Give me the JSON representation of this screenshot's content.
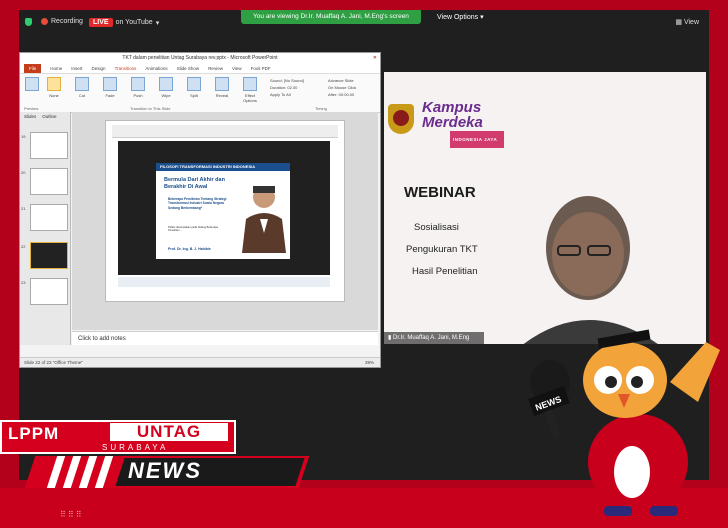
{
  "topbar": {
    "recording_label": "Recording",
    "live_badge": "LIVE",
    "youtube_label": "on YouTube",
    "screen_banner": "You are viewing Dr.Ir. Muaffaq A. Jani, M.Eng's screen",
    "view_options": "View Options",
    "view_button": "View"
  },
  "ppt": {
    "title": "TKT dalam penelitian Untag Surabaya rev.pptx - Microsoft PowerPoint",
    "tabs": [
      "File",
      "Home",
      "Insert",
      "Design",
      "Transitions",
      "Animations",
      "Slide Show",
      "Review",
      "View",
      "Foxit PDF"
    ],
    "ribbon": {
      "preview": "Preview",
      "transitions": [
        "None",
        "Cut",
        "Fade",
        "Push",
        "Wipe",
        "Split",
        "Reveal"
      ],
      "effect_options": "Effect Options",
      "group_transition": "Transition to This Slide",
      "sound": "Sound: [No Sound]",
      "duration": "Duration: 02.00",
      "apply_all": "Apply To All",
      "advance": "Advance Slide",
      "on_click": "On Mouse Click",
      "after": "After: 00:00.00",
      "group_timing": "Timing"
    },
    "pane_tabs": [
      "Slides",
      "Outline"
    ],
    "thumb_numbers": [
      "19",
      "20",
      "21",
      "22",
      "23"
    ],
    "slide": {
      "card_header": "FILOSOFI TRANSFORMASI INDUSTRI INDONESIA",
      "quote": "Bermula Dari Akhir dan Berakhir Di Awal",
      "subtext": "Beberapa Pemikiran Tentang Strategi Transformasi Industri Suatu Negara Sedang Berkembang*",
      "note": "Pidato disampaikan pada Sidang Beberapa Penelitian ...",
      "author": "Prof. Dr. Ing. B. J. Habibie"
    },
    "notes_placeholder": "Click to add notes",
    "status": "Slide 22 of 23   \"Office Theme\"",
    "zoom": "39%"
  },
  "webinar": {
    "brand_line1": "Kampus",
    "brand_line2": "Merdeka",
    "brand_tag": "INDONESIA JAYA",
    "title": "WEBINAR",
    "lines": [
      "Sosialisasi",
      "Pengukuran TKT",
      "Hasil Penelitian"
    ],
    "speaker_name": "Dr.Ir. Muaffaq A. Jani, M.Eng"
  },
  "overlay": {
    "lppm": "LPPM",
    "untag": "UNTAG",
    "surabaya": "SURABAYA",
    "news": "NEWS",
    "mic_label": "NEWS"
  },
  "colors": {
    "brand_red": "#d4001e",
    "zoom_bg": "#1f1f1f",
    "banner_green": "#2ea043",
    "kampus_purple": "#6a2c8f"
  }
}
